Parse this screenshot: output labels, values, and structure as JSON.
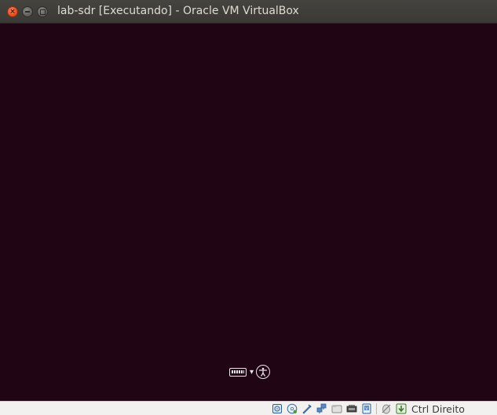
{
  "window": {
    "title": "lab-sdr [Executando] - Oracle VM VirtualBox",
    "close_glyph": "×"
  },
  "vm_screen": {
    "background_color": "#200514",
    "indicators": [
      "keyboard-icon",
      "accessibility-icon"
    ]
  },
  "statusbar": {
    "icons": [
      "hard-disk-icon",
      "optical-drive-icon",
      "audio-icon",
      "network-icon",
      "usb-icon",
      "shared-folders-icon",
      "display-icon",
      "video-capture-icon",
      "mouse-integration-icon",
      "host-key-arrow-icon"
    ],
    "host_key_label": "Ctrl Direito"
  }
}
